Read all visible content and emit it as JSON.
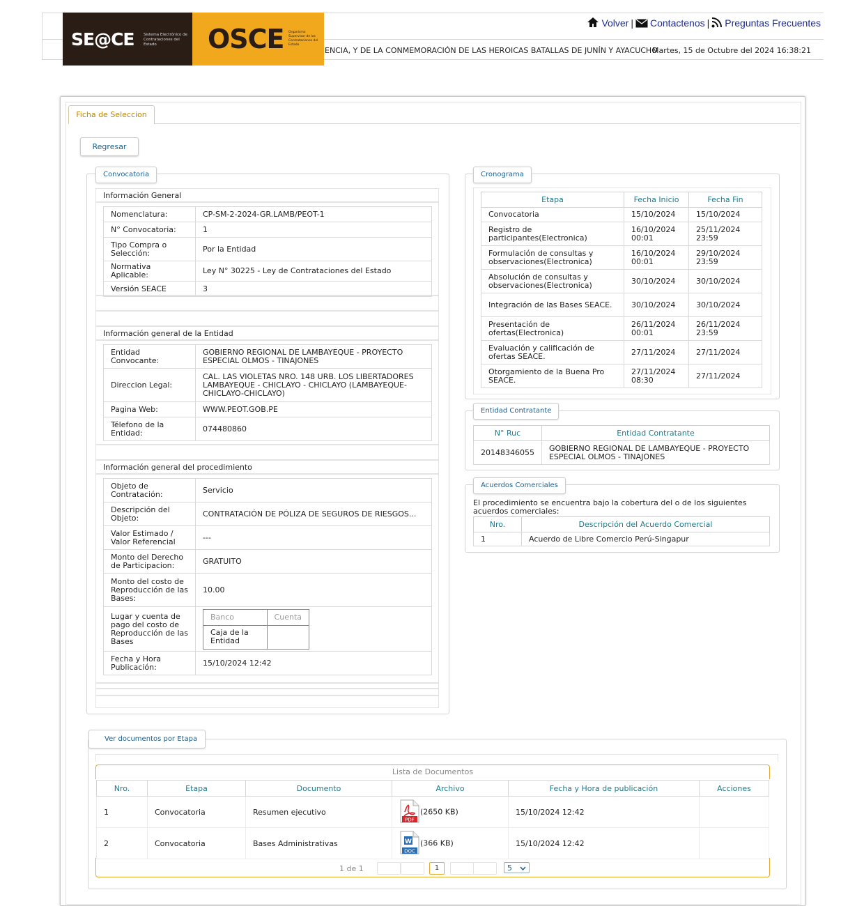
{
  "header": {
    "seace_logo_text": "SE@CE",
    "seace_logo_sub": "Sistema Electrónico de Contrataciones del Estado",
    "osce_logo_text": "OSCE",
    "osce_logo_sub": "Organismo Supervisor de las Contrataciones del Estado",
    "links": {
      "volver": "Volver",
      "contactenos": "Contactenos",
      "faq": "Preguntas Frecuentes"
    },
    "marquee": "ENCIA, Y DE LA CONMEMORACIÓN DE LAS HEROICAS BATALLAS DE JUNÍN Y AYACUCHO",
    "datetime": "Martes, 15 de Octubre del 2024 16:38:21"
  },
  "tab_label": "Ficha de Seleccion",
  "back_button": "Regresar",
  "convocatoria": {
    "legend": "Convocatoria",
    "general": {
      "title": "Información General",
      "rows": [
        {
          "k": "Nomenclatura:",
          "v": "CP-SM-2-2024-GR.LAMB/PEOT-1"
        },
        {
          "k": "N° Convocatoria:",
          "v": "1"
        },
        {
          "k": "Tipo Compra o Selección:",
          "v": "Por la Entidad"
        },
        {
          "k": "Normativa Aplicable:",
          "v": "Ley N° 30225 - Ley de Contrataciones del Estado"
        },
        {
          "k": "Versión SEACE",
          "v": "3"
        }
      ]
    },
    "entidad": {
      "title": "Información general de la Entidad",
      "rows": [
        {
          "k": "Entidad Convocante:",
          "v": "GOBIERNO REGIONAL DE LAMBAYEQUE - PROYECTO ESPECIAL OLMOS - TINAJONES"
        },
        {
          "k": "Direccion Legal:",
          "v": "CAL. LAS VIOLETAS NRO. 148 URB. LOS LIBERTADORES LAMBAYEQUE - CHICLAYO - CHICLAYO (LAMBAYEQUE-CHICLAYO-CHICLAYO)"
        },
        {
          "k": "Pagina Web:",
          "v": "WWW.PEOT.GOB.PE"
        },
        {
          "k": "Télefono de la Entidad:",
          "v": "074480860"
        }
      ]
    },
    "procedimiento": {
      "title": "Información general del procedimiento",
      "rows": [
        {
          "k": "Objeto de Contratación:",
          "v": "Servicio"
        },
        {
          "k": "Descripción del Objeto:",
          "v": "CONTRATACIÓN DE PÓLIZA DE SEGUROS DE RIESGOS..."
        },
        {
          "k": "Valor Estimado / Valor Referencial",
          "v": "---"
        },
        {
          "k": "Monto del Derecho de Participacion:",
          "v": "GRATUITO"
        },
        {
          "k": "Monto del costo de Reproducción de las Bases:",
          "v": "10.00"
        },
        {
          "k": "Lugar y cuenta de pago del costo de Reproducción de las Bases",
          "v": ""
        },
        {
          "k": "Fecha y Hora Publicación:",
          "v": "15/10/2024 12:42"
        }
      ],
      "pago_table": {
        "h_banco": "Banco",
        "h_cuenta": "Cuenta",
        "banco": "Caja de la Entidad",
        "cuenta": ""
      }
    }
  },
  "cronograma": {
    "legend": "Cronograma",
    "headers": [
      "Etapa",
      "Fecha Inicio",
      "Fecha Fin"
    ],
    "rows": [
      {
        "etapa": "Convocatoria",
        "inicio": "15/10/2024",
        "fin": "15/10/2024"
      },
      {
        "etapa": "Registro de participantes(Electronica)",
        "inicio": "16/10/2024 00:01",
        "fin": "25/11/2024 23:59"
      },
      {
        "etapa": "Formulación de consultas y observaciones(Electronica)",
        "inicio": "16/10/2024 00:01",
        "fin": "29/10/2024 23:59"
      },
      {
        "etapa": "Absolución de consultas y observaciones(Electronica)",
        "inicio": "30/10/2024",
        "fin": "30/10/2024"
      },
      {
        "etapa": "Integración de las Bases SEACE.",
        "inicio": "30/10/2024",
        "fin": "30/10/2024"
      },
      {
        "etapa": "Presentación de ofertas(Electronica)",
        "inicio": "26/11/2024 00:01",
        "fin": "26/11/2024 23:59"
      },
      {
        "etapa": "Evaluación y calificación de ofertas SEACE.",
        "inicio": "27/11/2024",
        "fin": "27/11/2024"
      },
      {
        "etapa": "Otorgamiento de la Buena Pro SEACE.",
        "inicio": "27/11/2024 08:30",
        "fin": "27/11/2024"
      }
    ]
  },
  "entidad_contratante": {
    "legend": "Entidad Contratante",
    "headers": [
      "N° Ruc",
      "Entidad Contratante"
    ],
    "ruc": "20148346055",
    "nombre": "GOBIERNO REGIONAL DE LAMBAYEQUE - PROYECTO ESPECIAL OLMOS - TINAJONES"
  },
  "acuerdos": {
    "legend": "Acuerdos Comerciales",
    "intro": "El procedimiento se encuentra bajo la cobertura del o de los siguientes acuerdos comerciales:",
    "headers": [
      "Nro.",
      "Descripción del Acuerdo Comercial"
    ],
    "rows": [
      {
        "nro": "1",
        "desc": "Acuerdo de Libre Comercio Perú-Singapur"
      }
    ]
  },
  "documentos": {
    "legend": "Ver documentos por Etapa",
    "caption": "Lista de Documentos",
    "headers": [
      "Nro.",
      "Etapa",
      "Documento",
      "Archivo",
      "Fecha y Hora de publicación",
      "Acciones"
    ],
    "rows": [
      {
        "nro": "1",
        "etapa": "Convocatoria",
        "doc": "Resumen ejecutivo",
        "icon": "pdf-icon",
        "icon_label": "PDF",
        "size": "(2650 KB)",
        "fecha": "15/10/2024 12:42"
      },
      {
        "nro": "2",
        "etapa": "Convocatoria",
        "doc": "Bases Administrativas",
        "icon": "doc-icon",
        "icon_label": "DOC",
        "size": "(366 KB)",
        "fecha": "15/10/2024 12:42"
      }
    ],
    "pager": {
      "info": "1 de 1",
      "current": "1",
      "page_size": "5"
    }
  }
}
